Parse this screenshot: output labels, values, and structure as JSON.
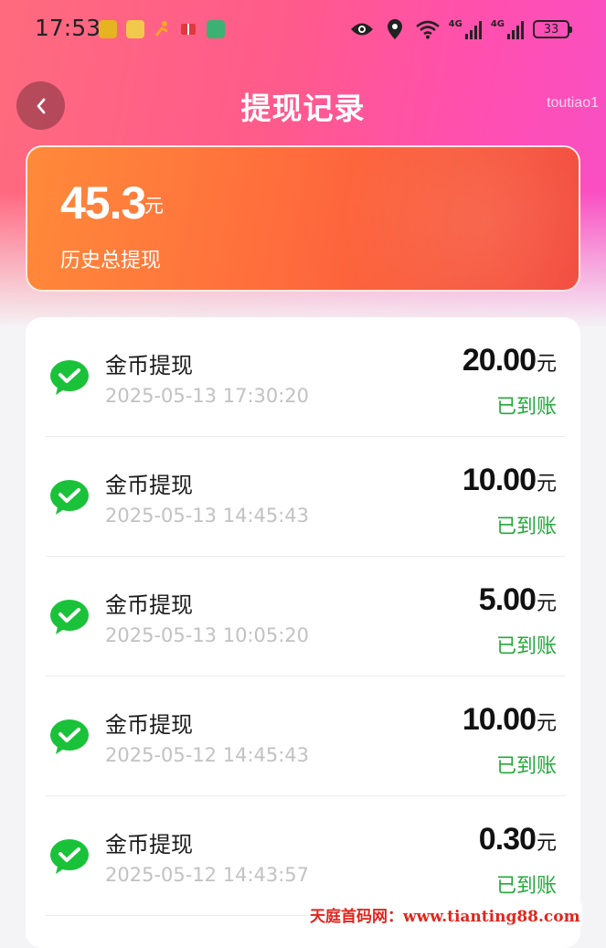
{
  "status_bar": {
    "time": "17:53",
    "net1": "4G",
    "net2": "4G",
    "battery": "33"
  },
  "header": {
    "title": "提现记录",
    "tag": "toutiao1"
  },
  "summary": {
    "amount": "45.3",
    "unit": "元",
    "label": "历史总提现"
  },
  "records": [
    {
      "title": "金币提现",
      "time": "2025-05-13 17:30:20",
      "amount": "20.00",
      "unit": "元",
      "status": "已到账"
    },
    {
      "title": "金币提现",
      "time": "2025-05-13 14:45:43",
      "amount": "10.00",
      "unit": "元",
      "status": "已到账"
    },
    {
      "title": "金币提现",
      "time": "2025-05-13 10:05:20",
      "amount": "5.00",
      "unit": "元",
      "status": "已到账"
    },
    {
      "title": "金币提现",
      "time": "2025-05-12 14:45:43",
      "amount": "10.00",
      "unit": "元",
      "status": "已到账"
    },
    {
      "title": "金币提现",
      "time": "2025-05-12 14:43:57",
      "amount": "0.30",
      "unit": "元",
      "status": "已到账"
    }
  ],
  "watermark": "天庭首码网：www.tianting88.com",
  "colors": {
    "status_green": "#25a83b",
    "wechat_green": "#1ac23a"
  }
}
